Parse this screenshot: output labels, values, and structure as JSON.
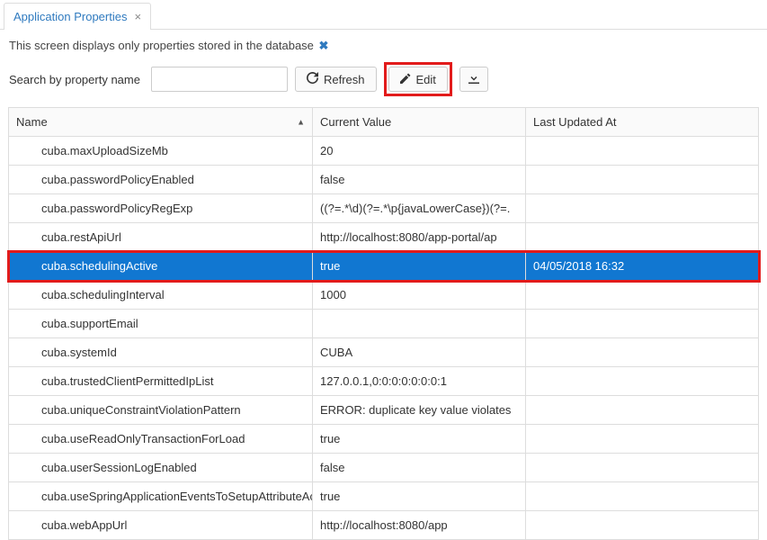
{
  "tab": {
    "title": "Application Properties"
  },
  "info": {
    "text": "This screen displays only properties stored in the database"
  },
  "toolbar": {
    "search_label": "Search by property name",
    "search_value": "",
    "refresh_label": "Refresh",
    "edit_label": "Edit"
  },
  "columns": {
    "name": "Name",
    "value": "Current Value",
    "updated": "Last Updated At"
  },
  "rows": [
    {
      "name": "cuba.maxUploadSizeMb",
      "value": "20",
      "updated": ""
    },
    {
      "name": "cuba.passwordPolicyEnabled",
      "value": "false",
      "updated": ""
    },
    {
      "name": "cuba.passwordPolicyRegExp",
      "value": "((?=.*\\d)(?=.*\\p{javaLowerCase})(?=.",
      "updated": ""
    },
    {
      "name": "cuba.restApiUrl",
      "value": "http://localhost:8080/app-portal/ap",
      "updated": ""
    },
    {
      "name": "cuba.schedulingActive",
      "value": "true",
      "updated": "04/05/2018 16:32"
    },
    {
      "name": "cuba.schedulingInterval",
      "value": "1000",
      "updated": ""
    },
    {
      "name": "cuba.supportEmail",
      "value": "",
      "updated": ""
    },
    {
      "name": "cuba.systemId",
      "value": "CUBA",
      "updated": ""
    },
    {
      "name": "cuba.trustedClientPermittedIpList",
      "value": "127.0.0.1,0:0:0:0:0:0:0:1",
      "updated": ""
    },
    {
      "name": "cuba.uniqueConstraintViolationPattern",
      "value": "ERROR: duplicate key value violates",
      "updated": ""
    },
    {
      "name": "cuba.useReadOnlyTransactionForLoad",
      "value": "true",
      "updated": ""
    },
    {
      "name": "cuba.userSessionLogEnabled",
      "value": "false",
      "updated": ""
    },
    {
      "name": "cuba.useSpringApplicationEventsToSetupAttributeAccess",
      "value": "true",
      "updated": ""
    },
    {
      "name": "cuba.webAppUrl",
      "value": "http://localhost:8080/app",
      "updated": ""
    }
  ],
  "selected_index": 4
}
